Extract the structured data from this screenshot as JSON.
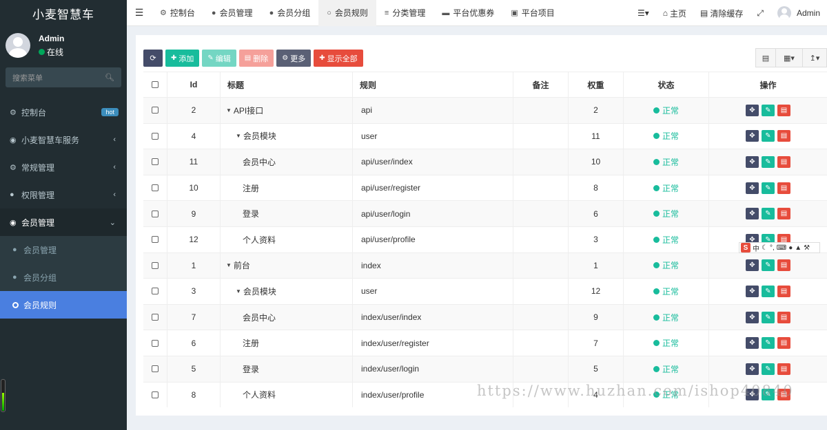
{
  "app": {
    "title": "小麦智慧车"
  },
  "user": {
    "name": "Admin",
    "status": "在线"
  },
  "search": {
    "placeholder": "搜索菜单"
  },
  "sidebar": {
    "items": [
      {
        "label": "控制台",
        "icon": "dashboard-icon",
        "badge": "hot"
      },
      {
        "label": "小麦智慧车服务",
        "icon": "car-icon"
      },
      {
        "label": "常规管理",
        "icon": "cogs-icon"
      },
      {
        "label": "权限管理",
        "icon": "group-icon"
      },
      {
        "label": "会员管理",
        "icon": "user-circle-icon"
      }
    ],
    "subitems": [
      {
        "label": "会员管理",
        "icon": "user-icon"
      },
      {
        "label": "会员分组",
        "icon": "users-icon"
      },
      {
        "label": "会员规则",
        "icon": "circle-icon"
      }
    ]
  },
  "topnav": {
    "tabs": [
      {
        "label": "控制台",
        "icon": "dashboard-icon"
      },
      {
        "label": "会员管理",
        "icon": "user-icon"
      },
      {
        "label": "会员分组",
        "icon": "users-icon"
      },
      {
        "label": "会员规则",
        "icon": "circle-icon"
      },
      {
        "label": "分类管理",
        "icon": "sliders-icon"
      },
      {
        "label": "平台优惠券",
        "icon": "card-icon"
      },
      {
        "label": "平台项目",
        "icon": "shop-icon"
      }
    ],
    "right": {
      "home": "主页",
      "clear_cache": "清除缓存",
      "user": "Admin"
    }
  },
  "toolbar": {
    "add": "添加",
    "edit": "编辑",
    "delete": "删除",
    "more": "更多",
    "show_all": "显示全部"
  },
  "table": {
    "headers": [
      "Id",
      "标题",
      "规则",
      "备注",
      "权重",
      "状态",
      "操作"
    ],
    "rows": [
      {
        "id": "2",
        "title": "API接口",
        "rule": "api",
        "remark": "",
        "weight": "2",
        "status": "正常",
        "level": 0,
        "expand": true
      },
      {
        "id": "4",
        "title": "会员模块",
        "rule": "user",
        "remark": "",
        "weight": "11",
        "status": "正常",
        "level": 1,
        "expand": true
      },
      {
        "id": "11",
        "title": "会员中心",
        "rule": "api/user/index",
        "remark": "",
        "weight": "10",
        "status": "正常",
        "level": 2,
        "expand": false
      },
      {
        "id": "10",
        "title": "注册",
        "rule": "api/user/register",
        "remark": "",
        "weight": "8",
        "status": "正常",
        "level": 2,
        "expand": false
      },
      {
        "id": "9",
        "title": "登录",
        "rule": "api/user/login",
        "remark": "",
        "weight": "6",
        "status": "正常",
        "level": 2,
        "expand": false
      },
      {
        "id": "12",
        "title": "个人资料",
        "rule": "api/user/profile",
        "remark": "",
        "weight": "3",
        "status": "正常",
        "level": 2,
        "expand": false
      },
      {
        "id": "1",
        "title": "前台",
        "rule": "index",
        "remark": "",
        "weight": "1",
        "status": "正常",
        "level": 0,
        "expand": true
      },
      {
        "id": "3",
        "title": "会员模块",
        "rule": "user",
        "remark": "",
        "weight": "12",
        "status": "正常",
        "level": 1,
        "expand": true
      },
      {
        "id": "7",
        "title": "会员中心",
        "rule": "index/user/index",
        "remark": "",
        "weight": "9",
        "status": "正常",
        "level": 2,
        "expand": false
      },
      {
        "id": "6",
        "title": "注册",
        "rule": "index/user/register",
        "remark": "",
        "weight": "7",
        "status": "正常",
        "level": 2,
        "expand": false
      },
      {
        "id": "5",
        "title": "登录",
        "rule": "index/user/login",
        "remark": "",
        "weight": "5",
        "status": "正常",
        "level": 2,
        "expand": false
      },
      {
        "id": "8",
        "title": "个人资料",
        "rule": "index/user/profile",
        "remark": "",
        "weight": "4",
        "status": "正常",
        "level": 2,
        "expand": false
      }
    ]
  },
  "ime": {
    "text": "中"
  },
  "watermark": "https://www.huzhan.com/ishop40840",
  "colors": {
    "sidebar_bg": "#222d32",
    "active_blue": "#4a7fe0",
    "green": "#18bc9c",
    "red": "#e74c3c",
    "dark": "#444c69"
  }
}
